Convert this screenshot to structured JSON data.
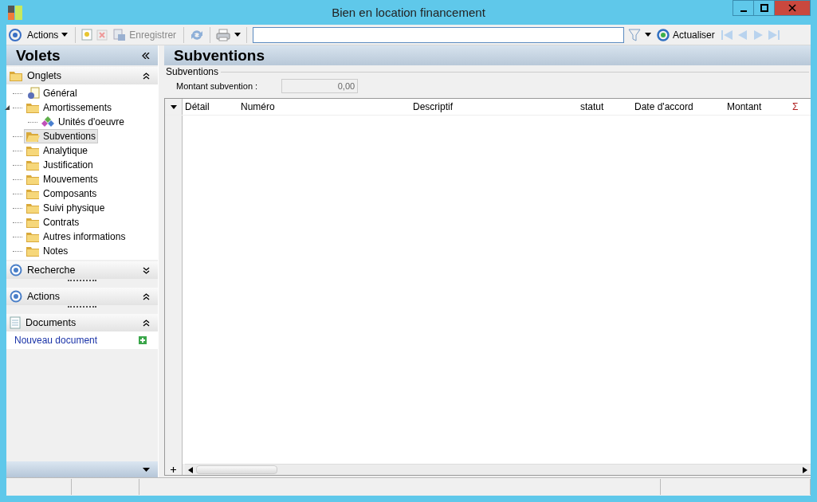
{
  "window": {
    "title": "Bien en location financement"
  },
  "toolbar": {
    "actions_label": "Actions",
    "save_label": "Enregistrer",
    "save_disabled": true,
    "refresh_label": "Actualiser"
  },
  "sidebar": {
    "title": "Volets",
    "sections": [
      {
        "kind": "tree",
        "title": "Onglets",
        "expanded": true,
        "items": [
          {
            "label": "Général",
            "kind": "document",
            "selected": false
          },
          {
            "label": "Amortissements",
            "kind": "folder",
            "selected": false,
            "expanded": true,
            "children": [
              {
                "label": "Unités d'oeuvre",
                "kind": "diamonds",
                "selected": false
              }
            ]
          },
          {
            "label": "Subventions",
            "kind": "folder",
            "selected": true
          },
          {
            "label": "Analytique",
            "kind": "folder",
            "selected": false
          },
          {
            "label": "Justification",
            "kind": "folder",
            "selected": false
          },
          {
            "label": "Mouvements",
            "kind": "folder",
            "selected": false
          },
          {
            "label": "Composants",
            "kind": "folder",
            "selected": false
          },
          {
            "label": "Suivi physique",
            "kind": "folder",
            "selected": false
          },
          {
            "label": "Contrats",
            "kind": "folder",
            "selected": false
          },
          {
            "label": "Autres informations",
            "kind": "folder",
            "selected": false
          },
          {
            "label": "Notes",
            "kind": "folder",
            "selected": false
          }
        ]
      },
      {
        "kind": "panel",
        "title": "Recherche",
        "expanded": false
      },
      {
        "kind": "panel",
        "title": "Actions",
        "expanded": true
      },
      {
        "kind": "documents",
        "title": "Documents",
        "expanded": true,
        "links": [
          "Nouveau document"
        ]
      }
    ]
  },
  "main": {
    "title": "Subventions",
    "group": "Subventions",
    "field": {
      "label": "Montant subvention :",
      "value": "0,00",
      "disabled": true
    },
    "table": {
      "columns": [
        "Détail",
        "Numéro",
        "Descriptif",
        "statut",
        "Date d'accord",
        "Montant"
      ],
      "sum_symbol": "Σ"
    }
  }
}
